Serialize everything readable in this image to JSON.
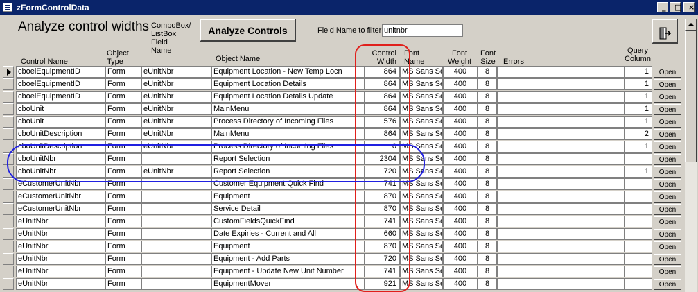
{
  "window": {
    "title": "zFormControlData"
  },
  "form": {
    "heading": "Analyze control widths",
    "combo_label": [
      "ComboBox/",
      "ListBox",
      "Field",
      "Name"
    ],
    "analyze_button": "Analyze Controls",
    "filter_label": "Field Name to filter",
    "filter_value": "unitnbr"
  },
  "columns": {
    "control_name": "Control Name",
    "object_type": [
      "Object",
      "Type"
    ],
    "object_name": "Object Name",
    "control_width": [
      "Control",
      "Width"
    ],
    "font_name": [
      "Font",
      "Name"
    ],
    "font_weight": [
      "Font",
      "Weight"
    ],
    "font_size": [
      "Font",
      "Size"
    ],
    "errors": "Errors",
    "query_column": [
      "Query",
      "Column"
    ]
  },
  "open_label": "Open",
  "rows": [
    {
      "control": "cboelEquipmentID",
      "type": "Form",
      "field": "eUnitNbr",
      "object": "Equipment Location - New Temp Locn",
      "width": "864",
      "font": "MS Sans Se",
      "weight": "400",
      "size": "8",
      "errors": "",
      "query": "1"
    },
    {
      "control": "cboelEquipmentID",
      "type": "Form",
      "field": "eUnitNbr",
      "object": "Equipment Location Details",
      "width": "864",
      "font": "MS Sans Se",
      "weight": "400",
      "size": "8",
      "errors": "",
      "query": "1"
    },
    {
      "control": "cboelEquipmentID",
      "type": "Form",
      "field": "eUnitNbr",
      "object": "Equipment Location Details Update",
      "width": "864",
      "font": "MS Sans Se",
      "weight": "400",
      "size": "8",
      "errors": "",
      "query": "1"
    },
    {
      "control": "cboUnit",
      "type": "Form",
      "field": "eUnitNbr",
      "object": "MainMenu",
      "width": "864",
      "font": "MS Sans Se",
      "weight": "400",
      "size": "8",
      "errors": "",
      "query": "1"
    },
    {
      "control": "cboUnit",
      "type": "Form",
      "field": "eUnitNbr",
      "object": "Process Directory of Incoming Files",
      "width": "576",
      "font": "MS Sans Se",
      "weight": "400",
      "size": "8",
      "errors": "",
      "query": "1"
    },
    {
      "control": "cboUnitDescription",
      "type": "Form",
      "field": "eUnitNbr",
      "object": "MainMenu",
      "width": "864",
      "font": "MS Sans Se",
      "weight": "400",
      "size": "8",
      "errors": "",
      "query": "2"
    },
    {
      "control": "cboUnitDescription",
      "type": "Form",
      "field": "eUnitNbr",
      "object": "Process Directory of Incoming Files",
      "width": "0",
      "font": "MS Sans Se",
      "weight": "400",
      "size": "8",
      "errors": "",
      "query": "1"
    },
    {
      "control": "cboUnitNbr",
      "type": "Form",
      "field": "",
      "object": "Report Selection",
      "width": "2304",
      "font": "MS Sans Se",
      "weight": "400",
      "size": "8",
      "errors": "",
      "query": ""
    },
    {
      "control": "cboUnitNbr",
      "type": "Form",
      "field": "eUnitNbr",
      "object": "Report Selection",
      "width": "720",
      "font": "MS Sans Se",
      "weight": "400",
      "size": "8",
      "errors": "",
      "query": "1"
    },
    {
      "control": "eCustomerUnitNbr",
      "type": "Form",
      "field": "",
      "object": "Customer Equipment Quick Find",
      "width": "741",
      "font": "MS Sans Se",
      "weight": "400",
      "size": "8",
      "errors": "",
      "query": ""
    },
    {
      "control": "eCustomerUnitNbr",
      "type": "Form",
      "field": "",
      "object": "Equipment",
      "width": "870",
      "font": "MS Sans Se",
      "weight": "400",
      "size": "8",
      "errors": "",
      "query": ""
    },
    {
      "control": "eCustomerUnitNbr",
      "type": "Form",
      "field": "",
      "object": "Service Detail",
      "width": "870",
      "font": "MS Sans Se",
      "weight": "400",
      "size": "8",
      "errors": "",
      "query": ""
    },
    {
      "control": "eUnitNbr",
      "type": "Form",
      "field": "",
      "object": "CustomFieldsQuickFind",
      "width": "741",
      "font": "MS Sans Se",
      "weight": "400",
      "size": "8",
      "errors": "",
      "query": ""
    },
    {
      "control": "eUnitNbr",
      "type": "Form",
      "field": "",
      "object": "Date Expiries - Current and All",
      "width": "660",
      "font": "MS Sans Se",
      "weight": "400",
      "size": "8",
      "errors": "",
      "query": ""
    },
    {
      "control": "eUnitNbr",
      "type": "Form",
      "field": "",
      "object": "Equipment",
      "width": "870",
      "font": "MS Sans Se",
      "weight": "400",
      "size": "8",
      "errors": "",
      "query": ""
    },
    {
      "control": "eUnitNbr",
      "type": "Form",
      "field": "",
      "object": "Equipment - Add Parts",
      "width": "720",
      "font": "MS Sans Se",
      "weight": "400",
      "size": "8",
      "errors": "",
      "query": ""
    },
    {
      "control": "eUnitNbr",
      "type": "Form",
      "field": "",
      "object": "Equipment - Update New Unit Number",
      "width": "741",
      "font": "MS Sans Se",
      "weight": "400",
      "size": "8",
      "errors": "",
      "query": ""
    },
    {
      "control": "eUnitNbr",
      "type": "Form",
      "field": "",
      "object": "EquipmentMover",
      "width": "921",
      "font": "MS Sans Se",
      "weight": "400",
      "size": "8",
      "errors": "",
      "query": ""
    }
  ],
  "colors": {
    "title_bar": "#0a246a",
    "window_bg": "#d4d0c8",
    "red_annotation": "#e0201c",
    "blue_annotation": "#2020e0"
  }
}
